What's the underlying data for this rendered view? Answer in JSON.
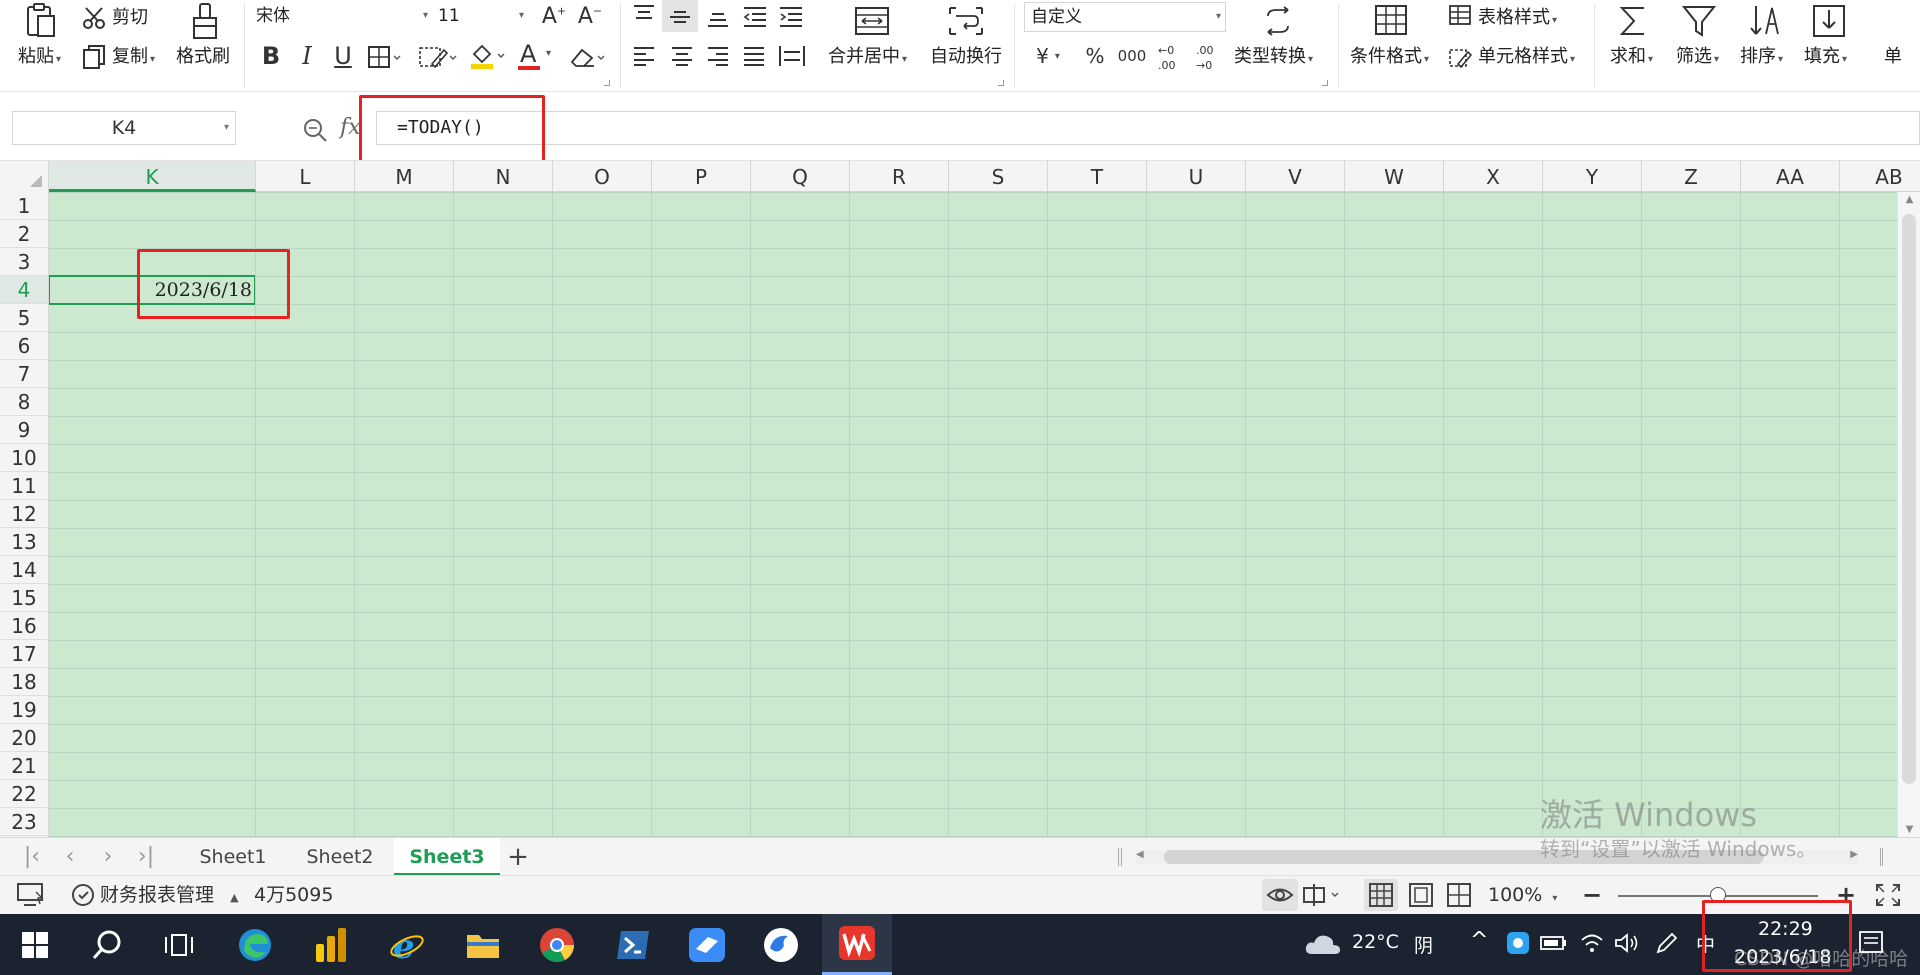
{
  "ribbon": {
    "paste": "粘贴",
    "cut": "剪切",
    "copy": "复制",
    "format_painter": "格式刷",
    "font_name": "宋体",
    "font_size": "11",
    "number_format": "自定义",
    "merge_center": "合并居中",
    "wrap_text": "自动换行",
    "currency_symbol": "¥",
    "percent_symbol": "%",
    "thousands_symbol": "000",
    "type_convert": "类型转换",
    "conditional_format": "条件格式",
    "table_style": "表格样式",
    "cell_style": "单元格样式",
    "sum": "求和",
    "filter": "筛选",
    "sort": "排序",
    "fill": "填充",
    "cell_more": "单",
    "bold": "B",
    "italic": "I",
    "underline": "U",
    "font_color_letter": "A",
    "accent_color": "#e52222"
  },
  "formula_bar": {
    "name_box": "K4",
    "fx_label": "fx",
    "formula": "=TODAY()"
  },
  "grid": {
    "columns": [
      "K",
      "L",
      "M",
      "N",
      "O",
      "P",
      "Q",
      "R",
      "S",
      "T",
      "U",
      "V",
      "W",
      "X",
      "Y",
      "Z",
      "AA",
      "AB"
    ],
    "rows": [
      "1",
      "2",
      "3",
      "4",
      "5",
      "6",
      "7",
      "8",
      "9",
      "10",
      "11",
      "12",
      "13",
      "14",
      "15",
      "16",
      "17",
      "18",
      "19",
      "20",
      "21",
      "22",
      "23"
    ],
    "active_column": "K",
    "active_row": "4",
    "active_cell_value": "2023/6/18",
    "fill_color": "#cce8cf",
    "selection_color": "#1f9d55"
  },
  "sheets": {
    "tabs": [
      "Sheet1",
      "Sheet2",
      "Sheet3"
    ],
    "active": "Sheet3",
    "add_label": "+"
  },
  "status_bar": {
    "report_manager": "财务报表管理",
    "sum_value": "4万5095",
    "zoom": "100%",
    "zoom_level_fraction": 0.5
  },
  "watermark": {
    "line1": "激活 Windows",
    "line2": "转到“设置”以激活 Windows。"
  },
  "taskbar": {
    "weather_temp": "22°C",
    "weather_text": "阴",
    "ime": "中",
    "time": "22:29",
    "date": "2023/6/18",
    "overlay_text": "CSDN @哈哈的哈哈"
  }
}
